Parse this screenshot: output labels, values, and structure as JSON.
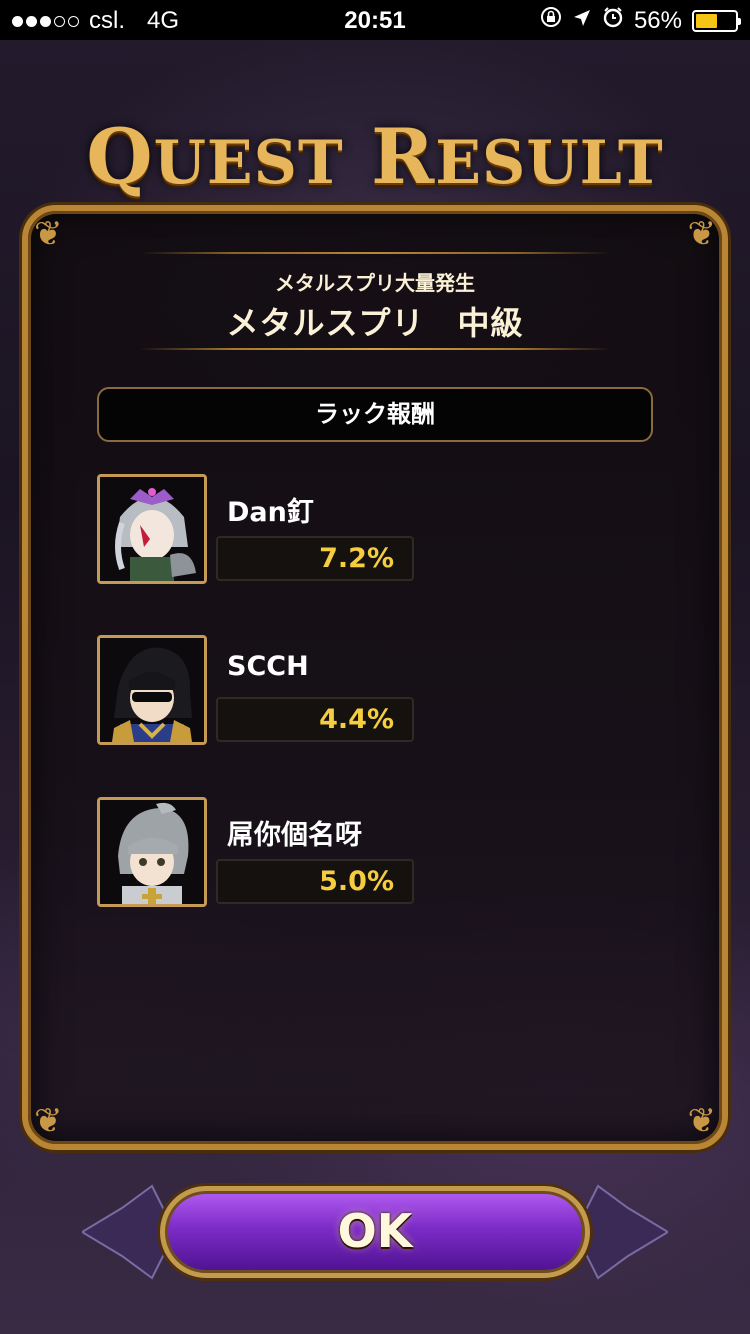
{
  "status_bar": {
    "carrier": "csl.",
    "network": "4G",
    "time": "20:51",
    "battery_percent": "56%",
    "battery_level": 0.56,
    "signal_bars_filled": 3,
    "signal_bars_total": 5,
    "icons": [
      "orientation-lock-icon",
      "location-arrow-icon",
      "alarm-icon"
    ]
  },
  "header": {
    "title_q": "Q",
    "title_uest": "UEST",
    "title_r": "R",
    "title_esult": "ESULT"
  },
  "quest": {
    "event_name": "メタルスプリ大量発生",
    "stage_name": "メタルスプリ　中級"
  },
  "section": {
    "label": "ラック報酬"
  },
  "players": [
    {
      "name": "Dan釘",
      "rate": "7.2%",
      "avatar": "masked-silver-hair-avatar"
    },
    {
      "name": "SCCH",
      "rate": "4.4%",
      "avatar": "black-hair-sunglasses-avatar"
    },
    {
      "name": "屌你個名呀",
      "rate": "5.0%",
      "avatar": "grey-hair-knight-avatar"
    }
  ],
  "ok_button": {
    "label": "OK"
  },
  "colors": {
    "gold": "#c59a55",
    "rate_text": "#f5cd3f",
    "ok_purple": "#7c2cc7",
    "battery": "#f6c415"
  }
}
